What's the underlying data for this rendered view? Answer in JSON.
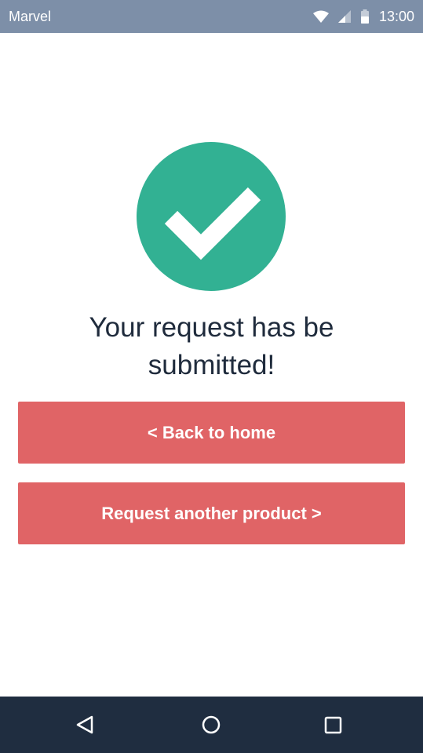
{
  "status_bar": {
    "app_name": "Marvel",
    "time": "13:00",
    "icons": [
      "wifi-icon",
      "cell-signal-icon",
      "battery-icon"
    ],
    "background_color": "#7d8fa8"
  },
  "confirmation": {
    "icon": "checkmark-icon",
    "icon_color": "#32b193",
    "message": "Your request has be\nsubmitted!"
  },
  "actions": {
    "back_label": "< Back to home",
    "request_another_label": "Request another product >",
    "button_color": "#e06466"
  },
  "nav_bar": {
    "icons": [
      "back-triangle-icon",
      "home-circle-icon",
      "recent-apps-square-icon"
    ],
    "background_color": "#1f2d40"
  }
}
